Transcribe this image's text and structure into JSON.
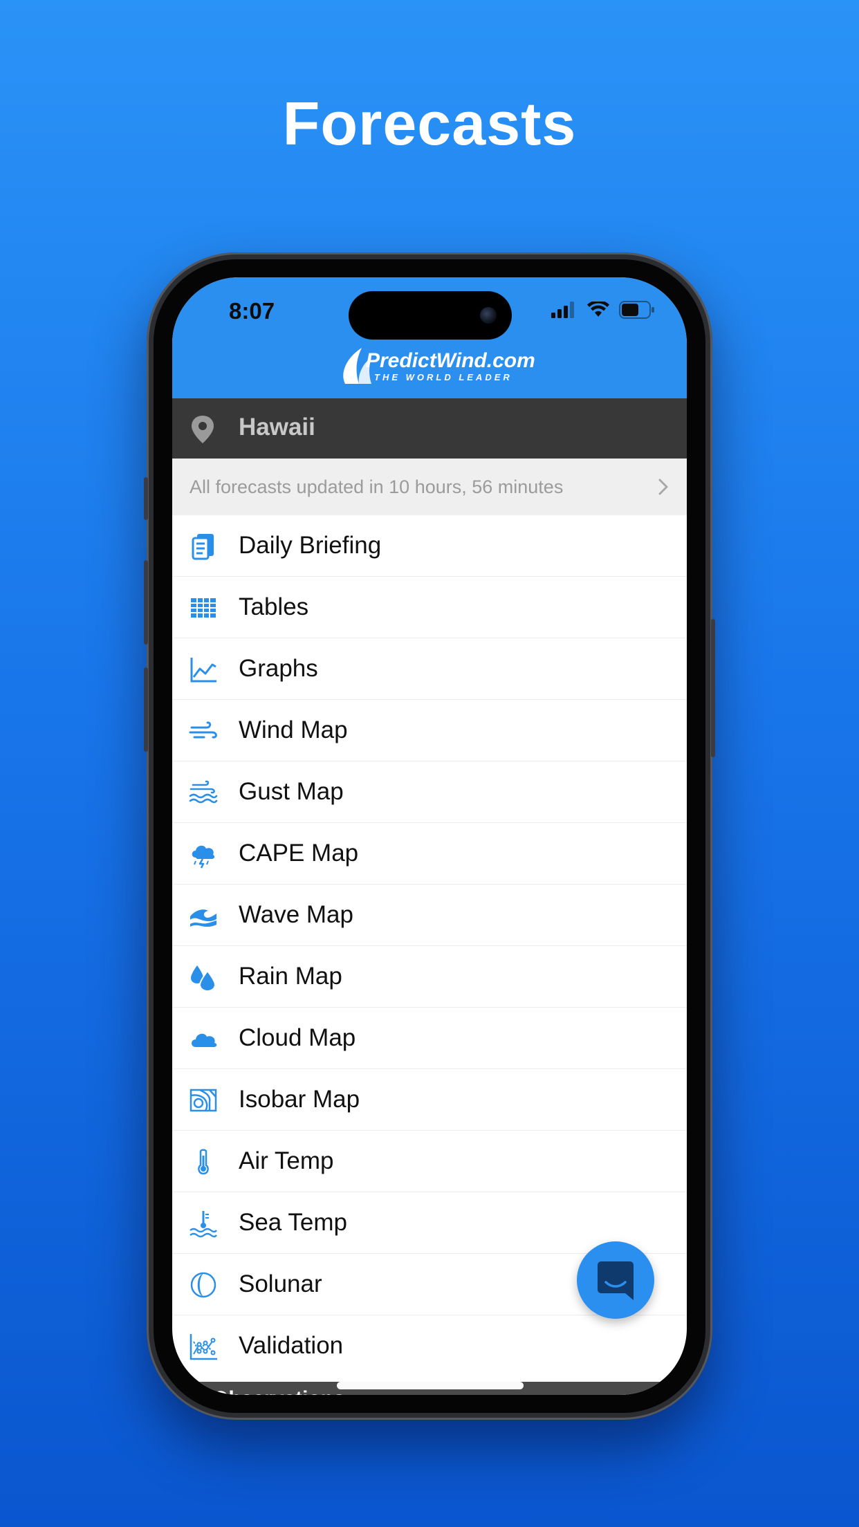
{
  "headline": "Forecasts",
  "status": {
    "time": "8:07"
  },
  "brand": {
    "name": "PredictWind.com",
    "tagline": "THE WORLD LEADER"
  },
  "location": {
    "name": "Hawaii"
  },
  "update_notice": "All forecasts updated in 10 hours, 56 minutes",
  "menu": [
    {
      "label": "Daily Briefing",
      "icon": "briefing-icon"
    },
    {
      "label": "Tables",
      "icon": "table-icon"
    },
    {
      "label": "Graphs",
      "icon": "graph-icon"
    },
    {
      "label": "Wind Map",
      "icon": "wind-icon"
    },
    {
      "label": "Gust Map",
      "icon": "gust-icon"
    },
    {
      "label": "CAPE Map",
      "icon": "storm-cloud-icon"
    },
    {
      "label": "Wave Map",
      "icon": "wave-icon"
    },
    {
      "label": "Rain Map",
      "icon": "rain-drops-icon"
    },
    {
      "label": "Cloud Map",
      "icon": "cloud-icon"
    },
    {
      "label": "Isobar Map",
      "icon": "isobar-icon"
    },
    {
      "label": "Air Temp",
      "icon": "thermometer-icon"
    },
    {
      "label": "Sea Temp",
      "icon": "sea-temp-icon"
    },
    {
      "label": "Solunar",
      "icon": "moon-icon"
    },
    {
      "label": "Validation",
      "icon": "validation-icon"
    }
  ],
  "section_next": "Observations",
  "colors": {
    "accent": "#2b8ff0",
    "location_bar": "#383838",
    "icon_blue": "#2a8fe8"
  }
}
